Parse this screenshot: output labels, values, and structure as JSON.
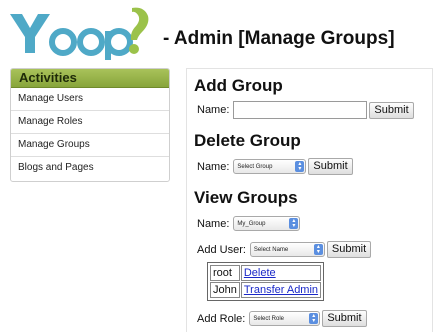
{
  "header": {
    "logo_text": "Yoop",
    "title": "- Admin [Manage Groups]"
  },
  "colors": {
    "logo_teal": "#4fa9c7",
    "logo_green": "#9bc24a",
    "sidebar_header": "#99b44a",
    "link": "#1a28c8",
    "select_arrow": "#5b8fe0"
  },
  "sidebar": {
    "title": "Activities",
    "items": [
      {
        "label": "Manage Users"
      },
      {
        "label": "Manage Roles"
      },
      {
        "label": "Manage Groups"
      },
      {
        "label": "Blogs and Pages"
      }
    ]
  },
  "add_group": {
    "heading": "Add Group",
    "name_label": "Name:",
    "name_value": "",
    "submit_label": "Submit"
  },
  "delete_group": {
    "heading": "Delete Group",
    "name_label": "Name:",
    "select_value": "Select Group",
    "submit_label": "Submit"
  },
  "view_groups": {
    "heading": "View Groups",
    "name_label": "Name:",
    "group_select_value": "My_Group",
    "add_user_label": "Add User:",
    "user_select_value": "Select Name",
    "add_user_submit": "Submit",
    "members": [
      {
        "name": "root",
        "action": "Delete"
      },
      {
        "name": "John",
        "action": "Transfer Admin"
      }
    ],
    "add_role_label": "Add Role:",
    "role_select_value": "Select Role",
    "add_role_submit": "Submit"
  },
  "icons": {
    "logo": "yoop-logo",
    "select_arrows": "updown-chevron-icon"
  }
}
